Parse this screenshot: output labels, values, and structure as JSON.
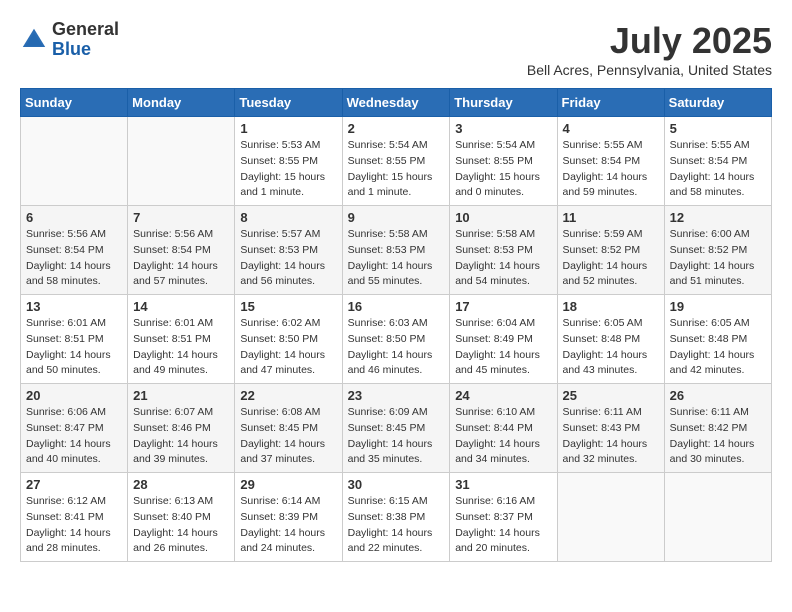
{
  "logo": {
    "general": "General",
    "blue": "Blue"
  },
  "header": {
    "title": "July 2025",
    "location": "Bell Acres, Pennsylvania, United States"
  },
  "weekdays": [
    "Sunday",
    "Monday",
    "Tuesday",
    "Wednesday",
    "Thursday",
    "Friday",
    "Saturday"
  ],
  "weeks": [
    [
      {
        "day": "",
        "sunrise": "",
        "sunset": "",
        "daylight": ""
      },
      {
        "day": "",
        "sunrise": "",
        "sunset": "",
        "daylight": ""
      },
      {
        "day": "1",
        "sunrise": "Sunrise: 5:53 AM",
        "sunset": "Sunset: 8:55 PM",
        "daylight": "Daylight: 15 hours and 1 minute."
      },
      {
        "day": "2",
        "sunrise": "Sunrise: 5:54 AM",
        "sunset": "Sunset: 8:55 PM",
        "daylight": "Daylight: 15 hours and 1 minute."
      },
      {
        "day": "3",
        "sunrise": "Sunrise: 5:54 AM",
        "sunset": "Sunset: 8:55 PM",
        "daylight": "Daylight: 15 hours and 0 minutes."
      },
      {
        "day": "4",
        "sunrise": "Sunrise: 5:55 AM",
        "sunset": "Sunset: 8:54 PM",
        "daylight": "Daylight: 14 hours and 59 minutes."
      },
      {
        "day": "5",
        "sunrise": "Sunrise: 5:55 AM",
        "sunset": "Sunset: 8:54 PM",
        "daylight": "Daylight: 14 hours and 58 minutes."
      }
    ],
    [
      {
        "day": "6",
        "sunrise": "Sunrise: 5:56 AM",
        "sunset": "Sunset: 8:54 PM",
        "daylight": "Daylight: 14 hours and 58 minutes."
      },
      {
        "day": "7",
        "sunrise": "Sunrise: 5:56 AM",
        "sunset": "Sunset: 8:54 PM",
        "daylight": "Daylight: 14 hours and 57 minutes."
      },
      {
        "day": "8",
        "sunrise": "Sunrise: 5:57 AM",
        "sunset": "Sunset: 8:53 PM",
        "daylight": "Daylight: 14 hours and 56 minutes."
      },
      {
        "day": "9",
        "sunrise": "Sunrise: 5:58 AM",
        "sunset": "Sunset: 8:53 PM",
        "daylight": "Daylight: 14 hours and 55 minutes."
      },
      {
        "day": "10",
        "sunrise": "Sunrise: 5:58 AM",
        "sunset": "Sunset: 8:53 PM",
        "daylight": "Daylight: 14 hours and 54 minutes."
      },
      {
        "day": "11",
        "sunrise": "Sunrise: 5:59 AM",
        "sunset": "Sunset: 8:52 PM",
        "daylight": "Daylight: 14 hours and 52 minutes."
      },
      {
        "day": "12",
        "sunrise": "Sunrise: 6:00 AM",
        "sunset": "Sunset: 8:52 PM",
        "daylight": "Daylight: 14 hours and 51 minutes."
      }
    ],
    [
      {
        "day": "13",
        "sunrise": "Sunrise: 6:01 AM",
        "sunset": "Sunset: 8:51 PM",
        "daylight": "Daylight: 14 hours and 50 minutes."
      },
      {
        "day": "14",
        "sunrise": "Sunrise: 6:01 AM",
        "sunset": "Sunset: 8:51 PM",
        "daylight": "Daylight: 14 hours and 49 minutes."
      },
      {
        "day": "15",
        "sunrise": "Sunrise: 6:02 AM",
        "sunset": "Sunset: 8:50 PM",
        "daylight": "Daylight: 14 hours and 47 minutes."
      },
      {
        "day": "16",
        "sunrise": "Sunrise: 6:03 AM",
        "sunset": "Sunset: 8:50 PM",
        "daylight": "Daylight: 14 hours and 46 minutes."
      },
      {
        "day": "17",
        "sunrise": "Sunrise: 6:04 AM",
        "sunset": "Sunset: 8:49 PM",
        "daylight": "Daylight: 14 hours and 45 minutes."
      },
      {
        "day": "18",
        "sunrise": "Sunrise: 6:05 AM",
        "sunset": "Sunset: 8:48 PM",
        "daylight": "Daylight: 14 hours and 43 minutes."
      },
      {
        "day": "19",
        "sunrise": "Sunrise: 6:05 AM",
        "sunset": "Sunset: 8:48 PM",
        "daylight": "Daylight: 14 hours and 42 minutes."
      }
    ],
    [
      {
        "day": "20",
        "sunrise": "Sunrise: 6:06 AM",
        "sunset": "Sunset: 8:47 PM",
        "daylight": "Daylight: 14 hours and 40 minutes."
      },
      {
        "day": "21",
        "sunrise": "Sunrise: 6:07 AM",
        "sunset": "Sunset: 8:46 PM",
        "daylight": "Daylight: 14 hours and 39 minutes."
      },
      {
        "day": "22",
        "sunrise": "Sunrise: 6:08 AM",
        "sunset": "Sunset: 8:45 PM",
        "daylight": "Daylight: 14 hours and 37 minutes."
      },
      {
        "day": "23",
        "sunrise": "Sunrise: 6:09 AM",
        "sunset": "Sunset: 8:45 PM",
        "daylight": "Daylight: 14 hours and 35 minutes."
      },
      {
        "day": "24",
        "sunrise": "Sunrise: 6:10 AM",
        "sunset": "Sunset: 8:44 PM",
        "daylight": "Daylight: 14 hours and 34 minutes."
      },
      {
        "day": "25",
        "sunrise": "Sunrise: 6:11 AM",
        "sunset": "Sunset: 8:43 PM",
        "daylight": "Daylight: 14 hours and 32 minutes."
      },
      {
        "day": "26",
        "sunrise": "Sunrise: 6:11 AM",
        "sunset": "Sunset: 8:42 PM",
        "daylight": "Daylight: 14 hours and 30 minutes."
      }
    ],
    [
      {
        "day": "27",
        "sunrise": "Sunrise: 6:12 AM",
        "sunset": "Sunset: 8:41 PM",
        "daylight": "Daylight: 14 hours and 28 minutes."
      },
      {
        "day": "28",
        "sunrise": "Sunrise: 6:13 AM",
        "sunset": "Sunset: 8:40 PM",
        "daylight": "Daylight: 14 hours and 26 minutes."
      },
      {
        "day": "29",
        "sunrise": "Sunrise: 6:14 AM",
        "sunset": "Sunset: 8:39 PM",
        "daylight": "Daylight: 14 hours and 24 minutes."
      },
      {
        "day": "30",
        "sunrise": "Sunrise: 6:15 AM",
        "sunset": "Sunset: 8:38 PM",
        "daylight": "Daylight: 14 hours and 22 minutes."
      },
      {
        "day": "31",
        "sunrise": "Sunrise: 6:16 AM",
        "sunset": "Sunset: 8:37 PM",
        "daylight": "Daylight: 14 hours and 20 minutes."
      },
      {
        "day": "",
        "sunrise": "",
        "sunset": "",
        "daylight": ""
      },
      {
        "day": "",
        "sunrise": "",
        "sunset": "",
        "daylight": ""
      }
    ]
  ]
}
